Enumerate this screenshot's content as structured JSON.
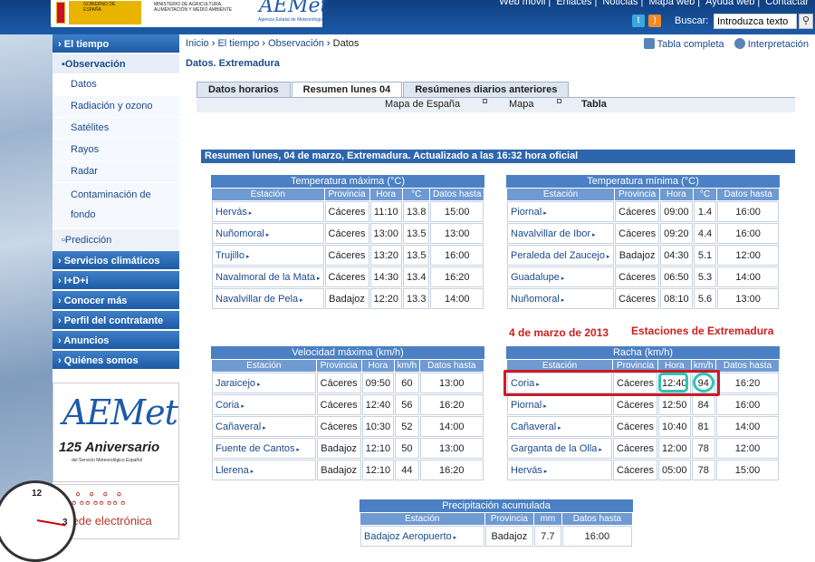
{
  "header": {
    "gov_left": "GOBIERNO DE ESPAÑA",
    "gov_right": "MINISTERIO DE AGRICULTURA, ALIMENTACIÓN Y MEDIO AMBIENTE",
    "logo": "AEMet",
    "logo_sub": "Agencia Estatal de Meteorología",
    "topnav": [
      "Web móvil",
      "Enlaces",
      "Noticias",
      "Mapa web",
      "Ayuda web",
      "Contactar"
    ],
    "search_label": "Buscar:",
    "search_value": "Introduzca texto",
    "icons": [
      "twitter-icon",
      "rss-icon",
      "search-icon"
    ],
    "colors": {
      "header_blue": "#1c5aa8",
      "nav_blue": "#2e66ad",
      "anno_red": "#cc1e1e",
      "anno_teal": "#2ec4b6"
    }
  },
  "sidebar": {
    "el_tiempo": "El tiempo",
    "observacion": "Observación",
    "items": [
      "Datos",
      "Radiación y ozono",
      "Satélites",
      "Rayos",
      "Radar",
      "Contaminación de fondo"
    ],
    "prediccion": "Predicción",
    "sections": [
      "Servicios climáticos",
      "I+D+i",
      "Conocer más",
      "Perfil del contratante",
      "Anuncios",
      "Quiénes somos"
    ],
    "banner1": {
      "logo": "AEMet",
      "line": "125 Aniversario",
      "sub": "del Servicio Meteorológico Español"
    },
    "banner2": {
      "text": "sede electrónica"
    }
  },
  "main": {
    "breadcrumb": [
      "Inicio",
      "El tiempo",
      "Observación",
      "Datos"
    ],
    "title": "Datos. Extremadura",
    "tools": [
      "Tabla completa",
      "Interpretación"
    ],
    "tabs": [
      "Datos horarios",
      "Resumen lunes 04",
      "Resúmenes diarios anteriores"
    ],
    "subtabs": [
      "Mapa de España",
      "Mapa",
      "Tabla"
    ],
    "summary": "Resumen lunes, 04 de marzo, Extremadura. Actualizado a las 16:32 hora oficial"
  },
  "tmax": {
    "caption": "Temperatura máxima (°C)",
    "headers": [
      "Estación",
      "Provincia",
      "Hora",
      "°C",
      "Datos hasta"
    ],
    "rows": [
      [
        "Hervás",
        "Cáceres",
        "11:10",
        "13.8",
        "15:00"
      ],
      [
        "Nuñomoral",
        "Cáceres",
        "13:00",
        "13.5",
        "13:00"
      ],
      [
        "Trujillo",
        "Cáceres",
        "13:20",
        "13.5",
        "16:00"
      ],
      [
        "Navalmoral de la Mata",
        "Cáceres",
        "14:30",
        "13.4",
        "16:20"
      ],
      [
        "Navalvillar de Pela",
        "Badajoz",
        "12:20",
        "13.3",
        "14:00"
      ]
    ]
  },
  "tmin": {
    "caption": "Temperatura mínima (°C)",
    "headers": [
      "Estación",
      "Provincia",
      "Hora",
      "°C",
      "Datos hasta"
    ],
    "rows": [
      [
        "Piornal",
        "Cáceres",
        "09:00",
        "1.4",
        "16:00"
      ],
      [
        "Navalvillar de Ibor",
        "Cáceres",
        "09:20",
        "4.4",
        "16:00"
      ],
      [
        "Peraleda del Zaucejo",
        "Badajoz",
        "04:30",
        "5.1",
        "12:00"
      ],
      [
        "Guadalupe",
        "Cáceres",
        "06:50",
        "5.3",
        "14:00"
      ],
      [
        "Nuñomoral",
        "Cáceres",
        "08:10",
        "5.6",
        "13:00"
      ]
    ]
  },
  "vmax": {
    "caption": "Velocidad máxima (km/h)",
    "headers": [
      "Estación",
      "Provincia",
      "Hora",
      "km/h",
      "Datos hasta"
    ],
    "rows": [
      [
        "Jaraicejo",
        "Cáceres",
        "09:50",
        "60",
        "13:00"
      ],
      [
        "Coria",
        "Cáceres",
        "12:40",
        "56",
        "16:20"
      ],
      [
        "Cañaveral",
        "Cáceres",
        "10:30",
        "52",
        "14:00"
      ],
      [
        "Fuente de Cantos",
        "Badajoz",
        "12:10",
        "50",
        "13:00"
      ],
      [
        "Llerena",
        "Badajoz",
        "12:10",
        "44",
        "16:20"
      ]
    ]
  },
  "racha": {
    "caption": "Racha (km/h)",
    "headers": [
      "Estación",
      "Provincia",
      "Hora",
      "km/h",
      "Datos hasta"
    ],
    "rows": [
      [
        "Coria",
        "Cáceres",
        "12:40",
        "94",
        "16:20"
      ],
      [
        "Piornal",
        "Cáceres",
        "12:50",
        "84",
        "16:00"
      ],
      [
        "Cañaveral",
        "Cáceres",
        "10:40",
        "81",
        "14:00"
      ],
      [
        "Garganta de la Olla",
        "Cáceres",
        "12:00",
        "78",
        "12:00"
      ],
      [
        "Hervás",
        "Cáceres",
        "05:00",
        "78",
        "15:00"
      ]
    ]
  },
  "precip": {
    "caption": "Precipitación acumulada",
    "headers": [
      "Estación",
      "Provincia",
      "mm",
      "Datos hasta"
    ],
    "rows": [
      [
        "Badajoz Aeropuerto",
        "Badajoz",
        "7.7",
        "16:00"
      ]
    ]
  },
  "annotations": {
    "date": "4 de marzo de 2013",
    "stations": "Estaciones de Extremadura"
  }
}
